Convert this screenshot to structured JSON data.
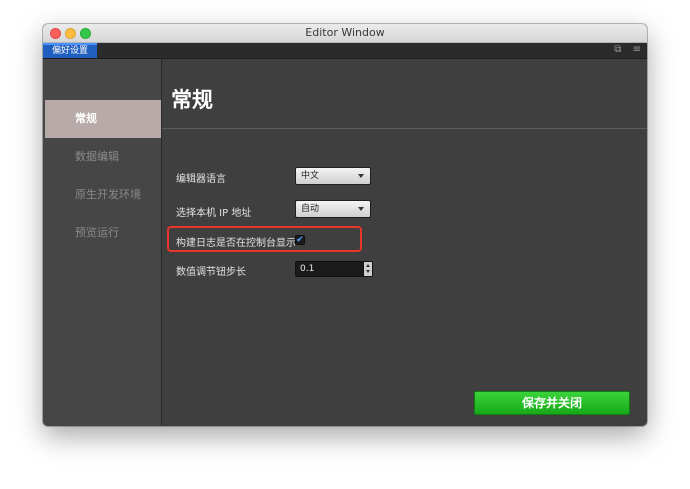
{
  "window": {
    "title": "Editor Window"
  },
  "tabbar": {
    "active_tab": "偏好设置",
    "icons": [
      "popout-icon",
      "menu-icon"
    ]
  },
  "sidebar": {
    "items": [
      {
        "label": "常规",
        "active": true
      },
      {
        "label": "数据编辑",
        "active": false
      },
      {
        "label": "原生开发环境",
        "active": false
      },
      {
        "label": "预览运行",
        "active": false
      }
    ]
  },
  "main": {
    "title": "常规",
    "settings": [
      {
        "label": "编辑器语言",
        "type": "select",
        "value": "中文"
      },
      {
        "label": "选择本机 IP 地址",
        "type": "select",
        "value": "自动"
      },
      {
        "label": "构建日志是否在控制台显示",
        "type": "checkbox",
        "checked": true
      },
      {
        "label": "数值调节钮步长",
        "type": "number",
        "value": "0.1"
      }
    ],
    "save_button": "保存并关闭"
  },
  "colors": {
    "accent_tab": "#1f5fbf",
    "save_green": "#22b822",
    "highlight_red": "#e8352a"
  }
}
